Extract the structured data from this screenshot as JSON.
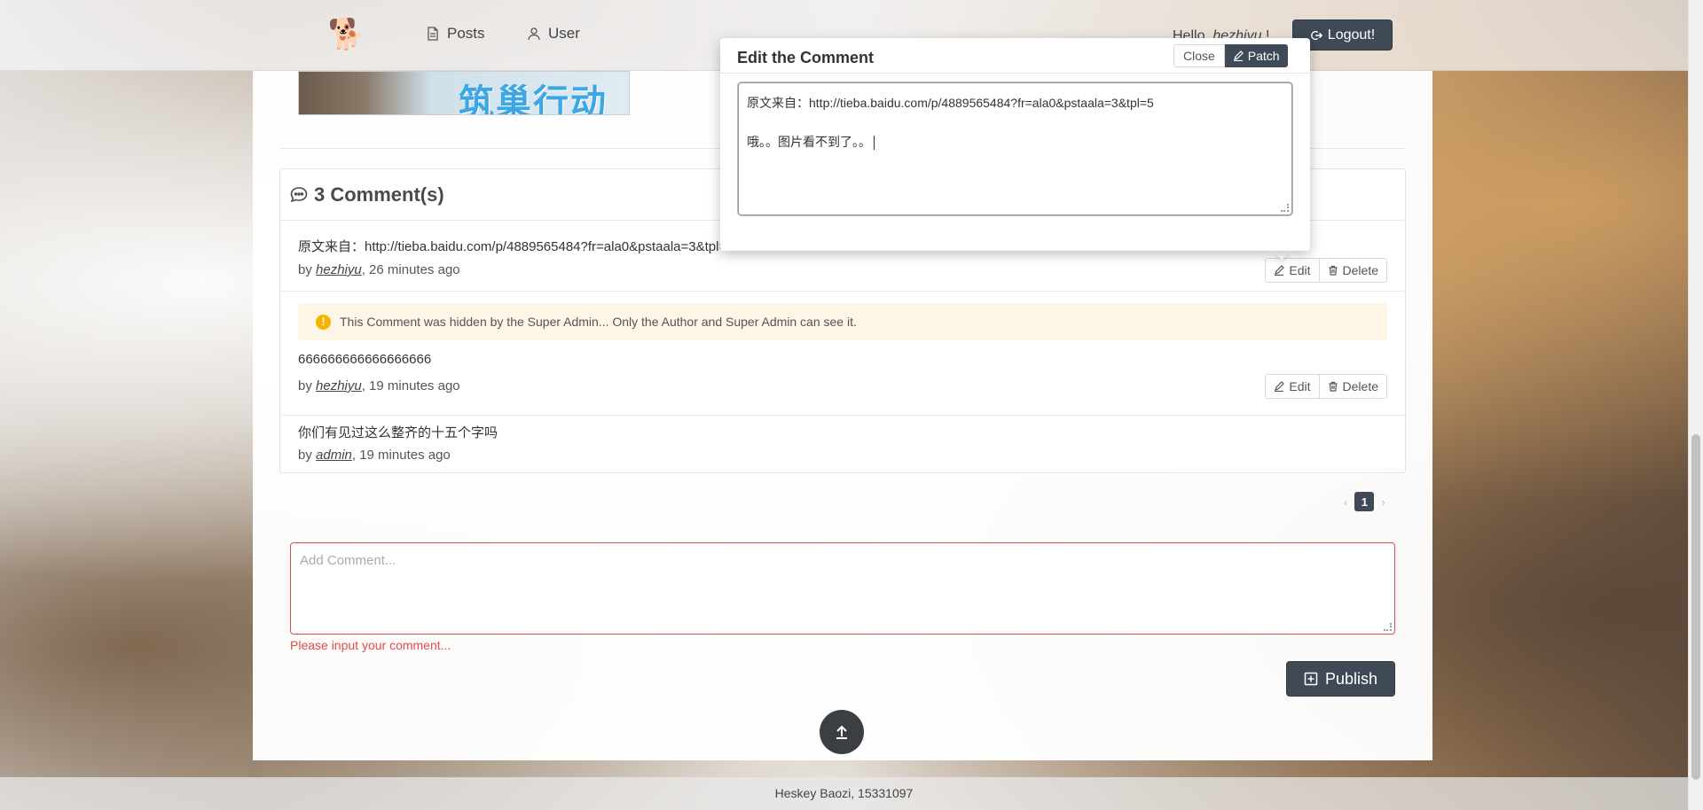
{
  "nav": {
    "logo_icon": "dog-logo-icon",
    "posts_label": "Posts",
    "user_label": "User",
    "hello_prefix": "Hello, ",
    "hello_user": "hezhiyu",
    "hello_suffix": " !",
    "logout_label": "Logout!"
  },
  "banner": {
    "text": "筑巢行动"
  },
  "comments": {
    "header": "3 Comment(s)",
    "items": [
      {
        "text": "原文来自：http://tieba.baidu.com/p/4889565484?fr=ala0&pstaala=3&tpl=5",
        "by": "by ",
        "author": "hezhiyu",
        "time": ", 26 minutes ago",
        "edit_label": "Edit",
        "delete_label": "Delete"
      },
      {
        "warning": "This Comment was hidden by the Super Admin... Only the Author and Super Admin can see it.",
        "text": "666666666666666666",
        "by": "by ",
        "author": "hezhiyu",
        "time": ", 19 minutes ago",
        "edit_label": "Edit",
        "delete_label": "Delete"
      },
      {
        "text": "你们有见过这么整齐的十五个字吗",
        "by": "by ",
        "author": "admin",
        "time": ", 19 minutes ago"
      }
    ]
  },
  "pagination": {
    "prev": "‹",
    "current": "1",
    "next": "›"
  },
  "add_comment": {
    "placeholder": "Add Comment...",
    "error": "Please input your comment...",
    "publish_label": "Publish"
  },
  "footer": {
    "text": "Heskey Baozi, 15331097"
  },
  "modal": {
    "title": "Edit the Comment",
    "close_label": "Close",
    "patch_label": "Patch",
    "line1": "原文来自：http://tieba.baidu.com/p/4889565484?fr=ala0&pstaala=3&tpl=5",
    "line2": "",
    "line3": "哦。。图片看不到了。。"
  },
  "colors": {
    "primary_dark": "#3f4a56",
    "error": "#e14b4b",
    "warning_bg": "#fdf6e6",
    "warning_icon": "#f5b400"
  }
}
